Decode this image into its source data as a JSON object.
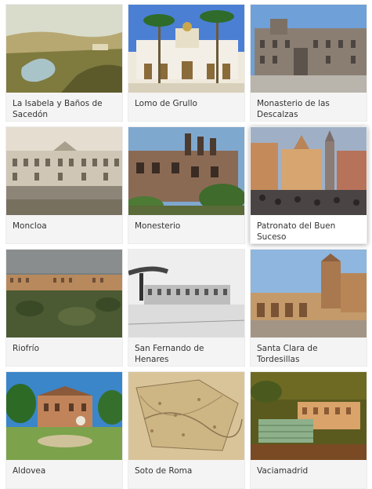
{
  "gallery": {
    "items": [
      {
        "title": "La Isabela y Baños de Sacedón",
        "image": "landscape-painting"
      },
      {
        "title": "Lomo de Grullo",
        "image": "palm-building"
      },
      {
        "title": "Monasterio de las Descalzas",
        "image": "stone-facade"
      },
      {
        "title": "Moncloa",
        "image": "old-photo-palace"
      },
      {
        "title": "Monesterio",
        "image": "ruined-building"
      },
      {
        "title": "Patronato del Buen Suceso",
        "image": "street-painting"
      },
      {
        "title": "Riofrío",
        "image": "distant-palace"
      },
      {
        "title": "San Fernando de Henares",
        "image": "engraving-factory"
      },
      {
        "title": "Santa Clara de Tordesillas",
        "image": "convent"
      },
      {
        "title": "Aldovea",
        "image": "garden-villa"
      },
      {
        "title": "Soto de Roma",
        "image": "old-map"
      },
      {
        "title": "Vaciamadrid",
        "image": "painted-estate"
      }
    ],
    "active_index": 5
  }
}
